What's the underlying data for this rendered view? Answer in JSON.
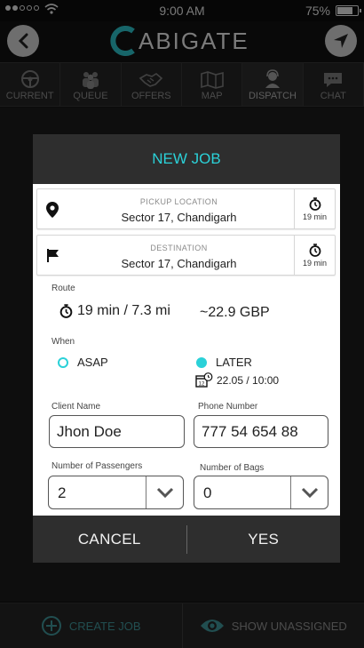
{
  "status_bar": {
    "time": "9:00 AM",
    "battery": "75%"
  },
  "header": {
    "logo_text": "ABIGATE"
  },
  "tabs": [
    {
      "label": "CURRENT",
      "icon": "steering-wheel-icon"
    },
    {
      "label": "QUEUE",
      "icon": "people-icon"
    },
    {
      "label": "OFFERS",
      "icon": "handshake-icon"
    },
    {
      "label": "MAP",
      "icon": "map-icon"
    },
    {
      "label": "DISPATCH",
      "icon": "operator-icon"
    },
    {
      "label": "CHAT",
      "icon": "chat-icon"
    }
  ],
  "active_tab": "DISPATCH",
  "bottom_bar": {
    "create_job": "CREATE JOB",
    "show_unassigned": "SHOW UNASSIGNED"
  },
  "modal": {
    "title": "NEW JOB",
    "pickup": {
      "caption": "PICKUP LOCATION",
      "value": "Sector 17, Chandigarh",
      "eta": "19 min"
    },
    "destination": {
      "caption": "DESTINATION",
      "value": "Sector 17, Chandigarh",
      "eta": "19 min"
    },
    "route": {
      "label": "Route",
      "time_distance": "19 min / 7.3 mi",
      "cost": "~22.9 GBP"
    },
    "when": {
      "label": "When",
      "asap": "ASAP",
      "later": "LATER",
      "later_selected": true,
      "later_datetime": "22.05 / 10:00",
      "calendar_day": "12"
    },
    "client_name": {
      "label": "Client Name",
      "value": "Jhon Doe"
    },
    "phone": {
      "label": "Phone Number",
      "value": "777 54 654 88"
    },
    "passengers": {
      "label": "Number of Passengers",
      "value": "2"
    },
    "bags": {
      "label": "Number of Bags",
      "value": "0"
    },
    "cancel": "CANCEL",
    "confirm": "YES"
  },
  "colors": {
    "accent": "#2bd1d8",
    "dark_panel": "#2e2e2e"
  }
}
